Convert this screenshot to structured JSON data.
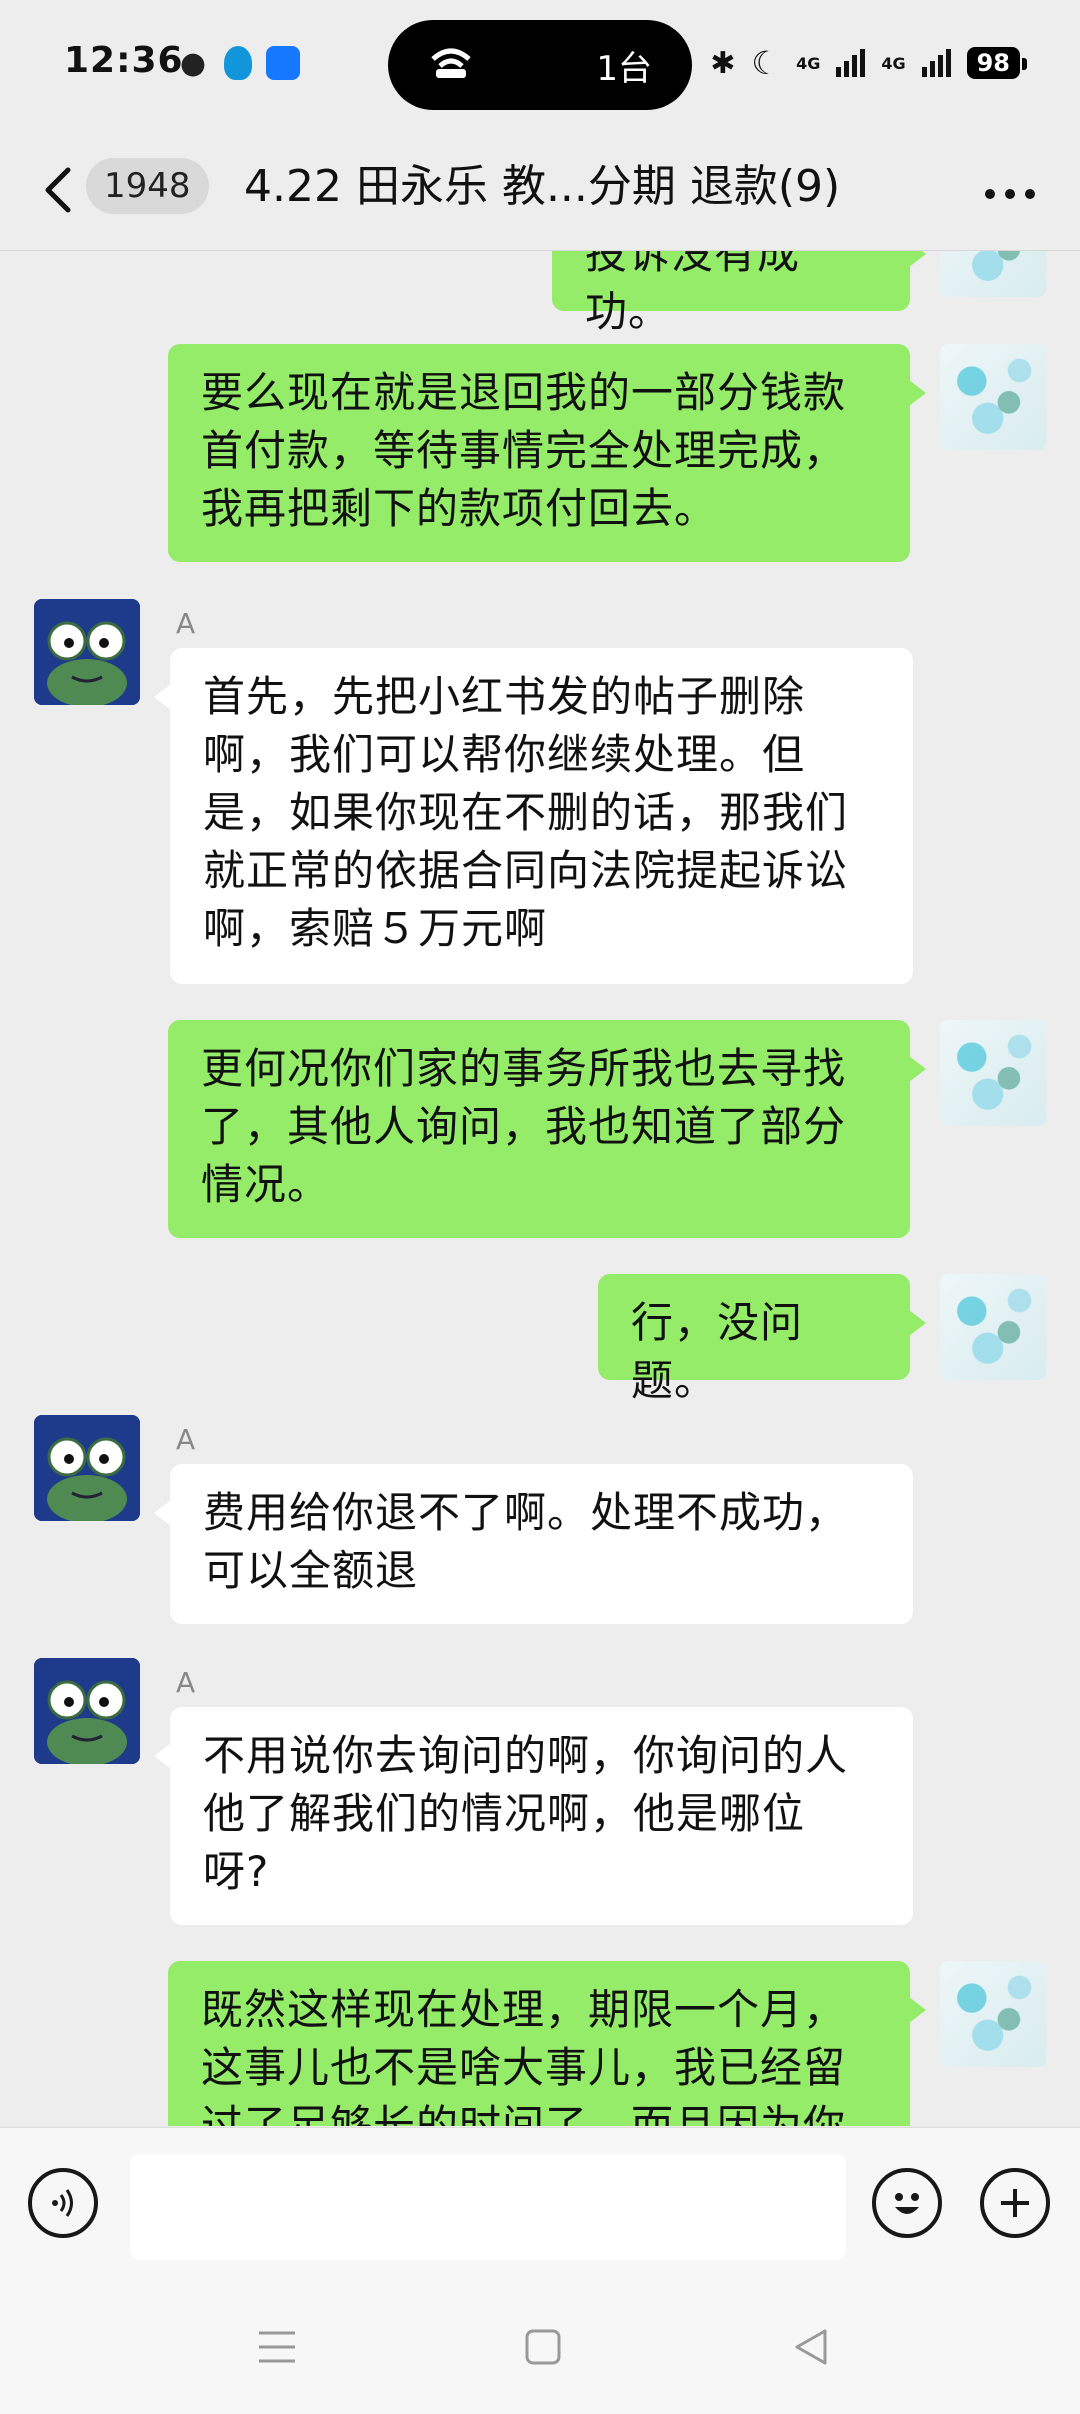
{
  "status": {
    "time": "12:36",
    "pill_text": "1台",
    "network_1": "4G",
    "network_2": "4G",
    "battery": "98"
  },
  "header": {
    "unread_count": "1948",
    "title": "4.22 田永乐 教...分期 退款(9)"
  },
  "messages": [
    {
      "side": "me",
      "sender": "",
      "text": "投诉没有成功。"
    },
    {
      "side": "me",
      "sender": "",
      "text": "要么现在就是退回我的一部分钱款\n首付款，等待事情完全处理完成，\n我再把剩下的款项付回去。"
    },
    {
      "side": "them",
      "sender": "A",
      "text": "首先，先把小红书发的帖子删除\n啊，我们可以帮你继续处理。但\n是，如果你现在不删的话，那我们\n就正常的依据合同向法院提起诉讼\n啊，索赔５万元啊"
    },
    {
      "side": "me",
      "sender": "",
      "text": "更何况你们家的事务所我也去寻找\n了，其他人询问，我也知道了部分\n情况。"
    },
    {
      "side": "me",
      "sender": "",
      "text": "行，没问题。"
    },
    {
      "side": "them",
      "sender": "A",
      "text": "费用给你退不了啊。处理不成功，\n可以全额退"
    },
    {
      "side": "them",
      "sender": "A",
      "text": "不用说你去询问的啊，你询问的人\n他了解我们的情况啊，他是哪位\n呀?"
    },
    {
      "side": "me",
      "sender": "",
      "text": "既然这样现在处理，期限一个月，\n这事儿也不是啥大事儿，我已经留\n过了足够长的时间了，而且因为你"
    }
  ],
  "icons": {
    "back": "chevron-left-icon",
    "more": "more-dots-icon",
    "voice": "voice-icon",
    "emoji": "emoji-icon",
    "plus": "plus-icon",
    "nav_menu": "menu-icon",
    "nav_home": "home-square-icon",
    "nav_back": "back-triangle-icon"
  },
  "colors": {
    "my_bubble": "#95ec69",
    "their_bubble": "#ffffff",
    "background": "#ededed"
  }
}
